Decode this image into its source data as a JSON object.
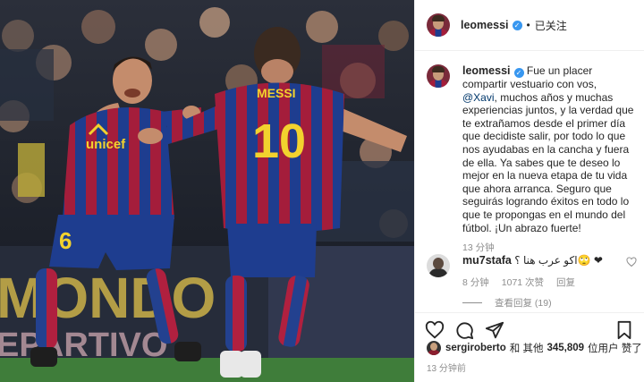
{
  "photo": {
    "left_jersey_sponsor": "unicef",
    "left_jersey_number": "6",
    "right_jersey_name": "MESSI",
    "right_jersey_number": "10",
    "board_text_top": "MONDO",
    "board_text_bottom": "EPARTIVO"
  },
  "header": {
    "username": "leomessi",
    "separator": "•",
    "follow_state": "已关注"
  },
  "caption": {
    "username": "leomessi",
    "text_before_mention": "Fue un placer compartir vestuario con vos,",
    "mention": "@Xavi",
    "text_after_mention": ", muchos años y muchas experiencias juntos, y la verdad que te extrañamos desde el primer día que decidiste salir, por todo lo que nos ayudabas en la cancha y fuera de ella. Ya sabes que te deseo lo mejor en la nueva etapa de tu vida que ahora arranca. Seguro que seguirás logrando éxitos en todo lo que te propongas en el mundo del fútbol. ¡Un abrazo fuerte!",
    "time": "13 分钟"
  },
  "comment": {
    "username": "mu7stafa",
    "text": "اكو عرب هنا ؟🙄 ❤",
    "time": "8 分钟",
    "likes": "1071 次赞",
    "reply": "回复",
    "view_replies": "查看回复 (19)"
  },
  "likes": {
    "liker": "sergiroberto",
    "connector": "和 其他",
    "count": "345,809",
    "suffix": "位用户 赞了"
  },
  "post_time": "13 分钟前",
  "colors": {
    "link": "#00376b",
    "verified": "#3897f0",
    "muted": "#8e8e8e",
    "barca_red": "#a41d3b",
    "barca_blue": "#1e3d8f",
    "jersey_gold": "#f2d22e"
  },
  "icons": [
    "verified-badge-icon",
    "heart-icon",
    "comment-icon",
    "share-icon",
    "bookmark-icon",
    "small-heart-icon"
  ]
}
